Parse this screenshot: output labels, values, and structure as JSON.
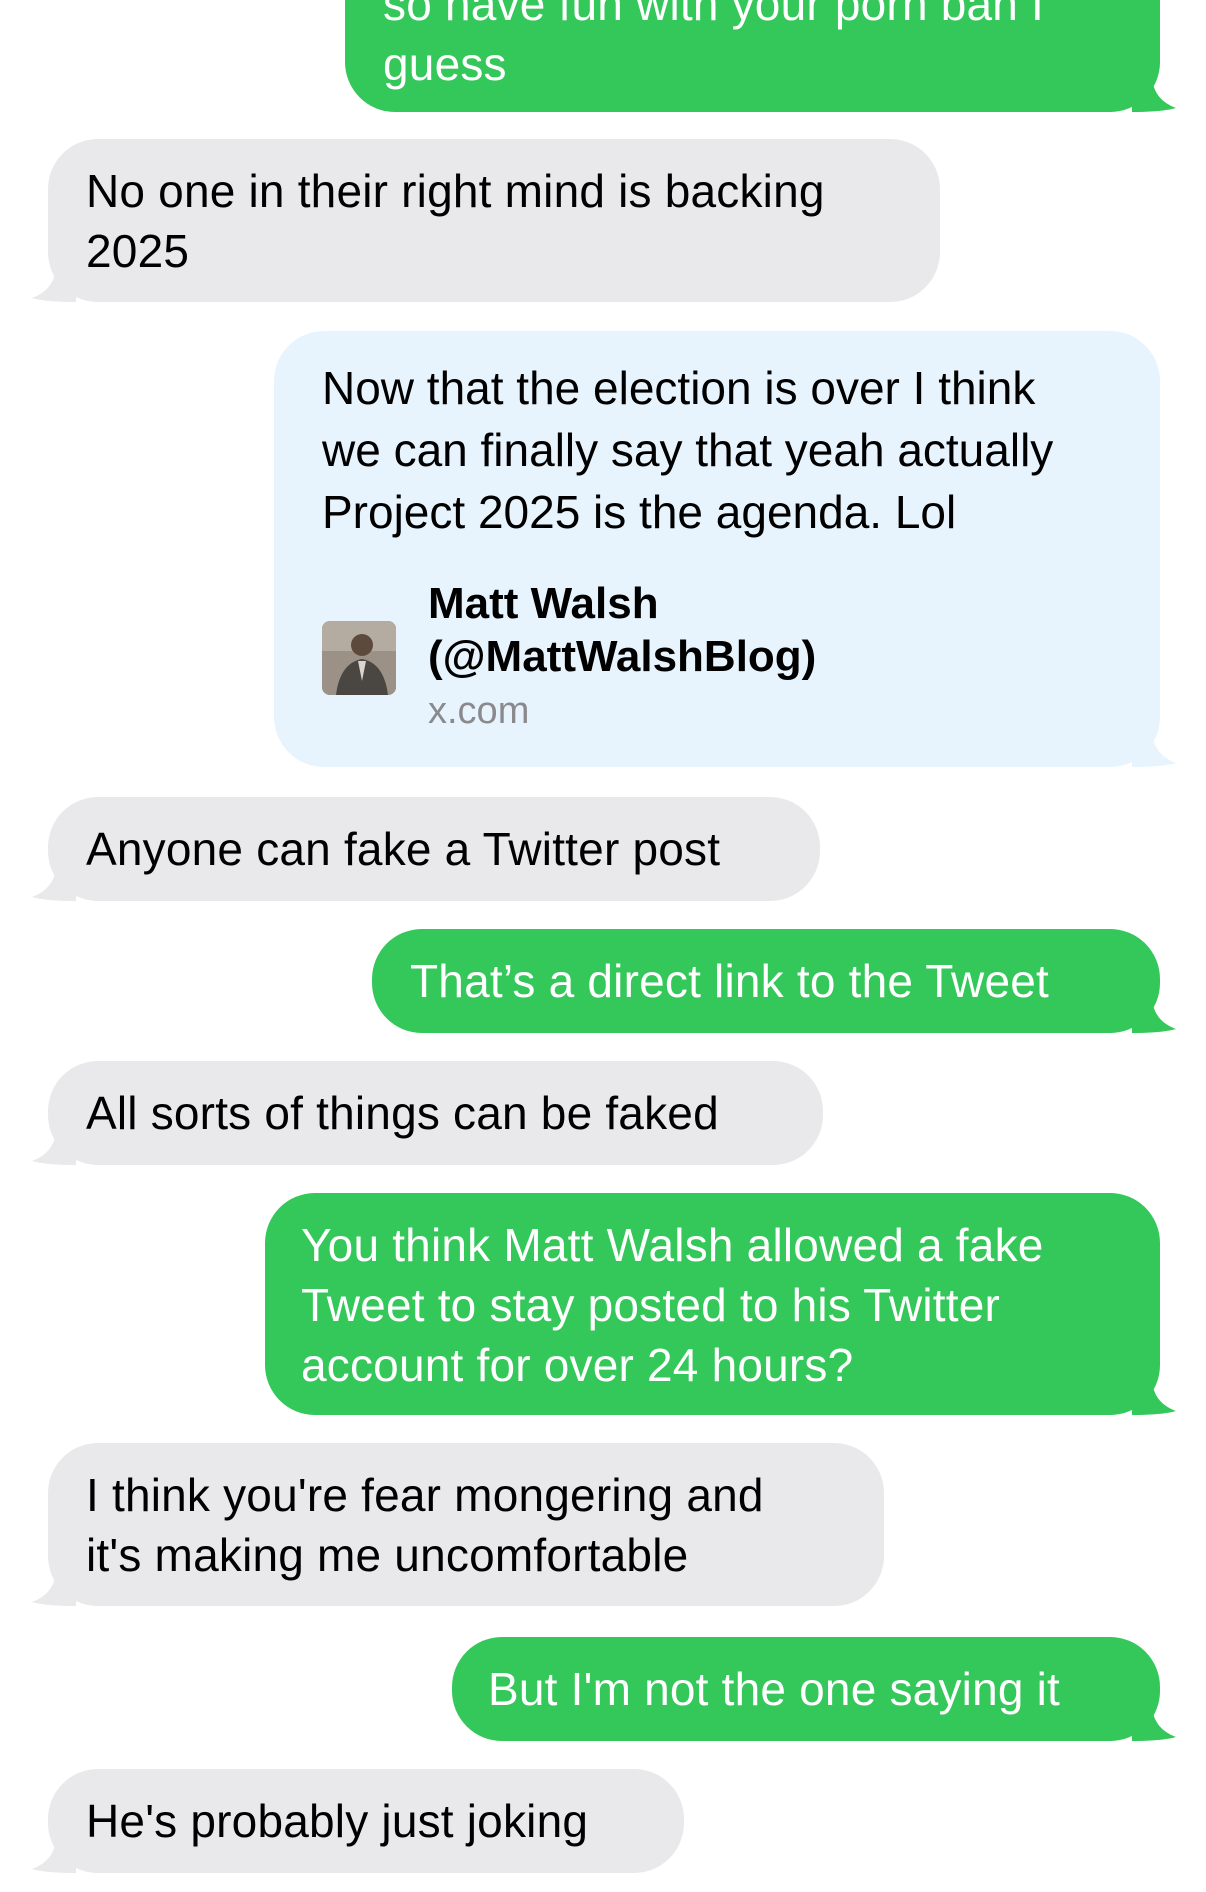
{
  "messages": [
    {
      "id": "m0",
      "side": "outgoing",
      "text": "so have fun with your porn ban I\nguess"
    },
    {
      "id": "m1",
      "side": "incoming",
      "text": "No one in their right mind is backing\n2025"
    },
    {
      "id": "m2",
      "side": "outgoing",
      "type": "link",
      "text": "Now that the election is over I think\nwe can finally say that yeah actually\nProject 2025 is the agenda. Lol",
      "preview_title": "Matt Walsh\n(@MattWalshBlog)",
      "preview_domain": "x.com",
      "preview_icon": "profile-photo"
    },
    {
      "id": "m3",
      "side": "incoming",
      "text": "Anyone can fake a Twitter post"
    },
    {
      "id": "m4",
      "side": "outgoing",
      "text": "That’s a direct link to the Tweet"
    },
    {
      "id": "m5",
      "side": "incoming",
      "text": "All sorts of things can be faked"
    },
    {
      "id": "m6",
      "side": "outgoing",
      "text": "You think Matt Walsh allowed a fake\nTweet to stay posted to his Twitter\naccount for over 24 hours?"
    },
    {
      "id": "m7",
      "side": "incoming",
      "text": "I think you're fear mongering and\nit's making me uncomfortable"
    },
    {
      "id": "m8",
      "side": "outgoing",
      "text": "But I'm not the one saying it"
    },
    {
      "id": "m9",
      "side": "incoming",
      "text": "He's probably just joking"
    }
  ],
  "colors": {
    "incoming_bubble": "#e9e9eb",
    "outgoing_bubble": "#34c759",
    "link_bubble": "#e8f4fd",
    "preview_domain": "#8a8a8e"
  }
}
